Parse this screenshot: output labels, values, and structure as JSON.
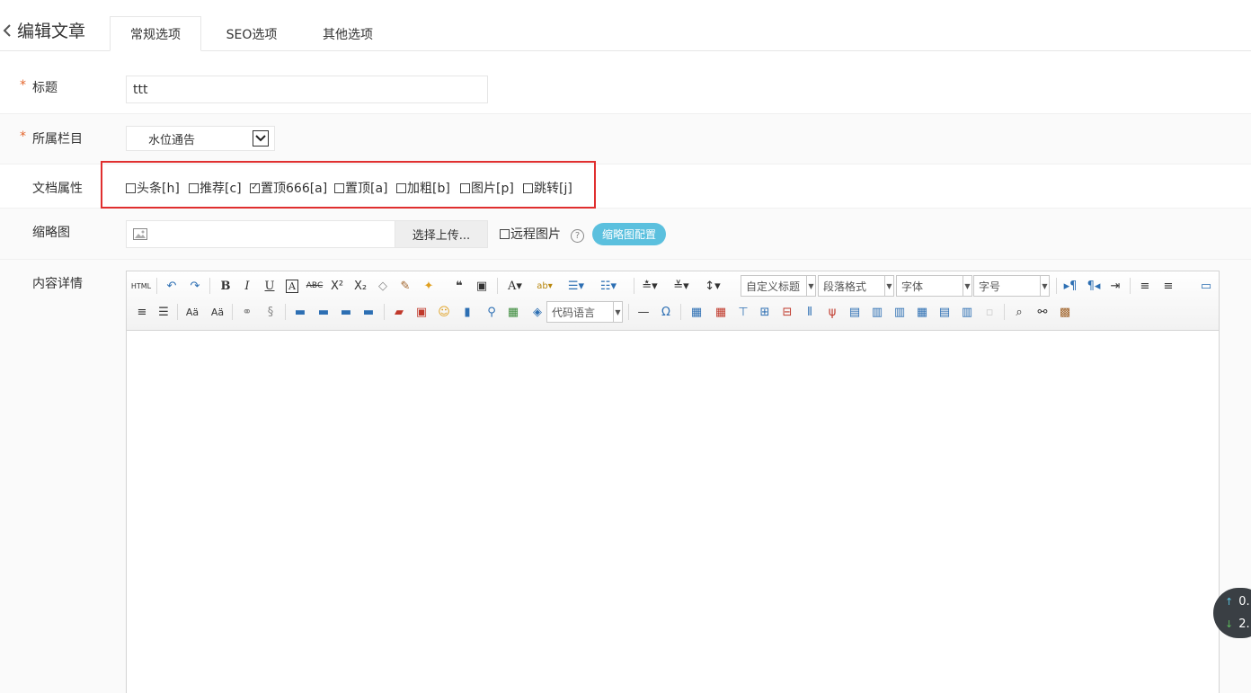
{
  "header": {
    "back_label": "编辑文章",
    "tabs": [
      {
        "label": "常规选项",
        "active": true
      },
      {
        "label": "SEO选项",
        "active": false
      },
      {
        "label": "其他选项",
        "active": false
      }
    ]
  },
  "form": {
    "title": {
      "required_mark": "*",
      "label": "标题",
      "value": "ttt"
    },
    "column": {
      "required_mark": "*",
      "label": "所属栏目",
      "selected": "水位通告"
    },
    "attributes": {
      "label": "文档属性",
      "options": [
        {
          "label": "头条[h]",
          "checked": false
        },
        {
          "label": "推荐[c]",
          "checked": false
        },
        {
          "label": "置顶666[a]",
          "checked": true
        },
        {
          "label": "置顶[a]",
          "checked": false
        },
        {
          "label": "加粗[b]",
          "checked": false
        },
        {
          "label": "图片[p]",
          "checked": false
        },
        {
          "label": "跳转[j]",
          "checked": false
        }
      ],
      "highlight_color": "#e02f2f"
    },
    "thumbnail": {
      "label": "缩略图",
      "upload_button": "选择上传...",
      "remote_label": "远程图片",
      "remote_checked": false,
      "help": "?",
      "config_button": "缩略图配置"
    },
    "content": {
      "label": "内容详情",
      "toolbar_selects": {
        "custom_title": "自定义标题",
        "paragraph": "段落格式",
        "font": "字体",
        "font_size": "字号",
        "code_lang": "代码语言"
      }
    }
  },
  "float_widget": {
    "up": "0.",
    "down": "2."
  },
  "colors": {
    "accent": "#5bc0de",
    "required": "#e4652b"
  }
}
